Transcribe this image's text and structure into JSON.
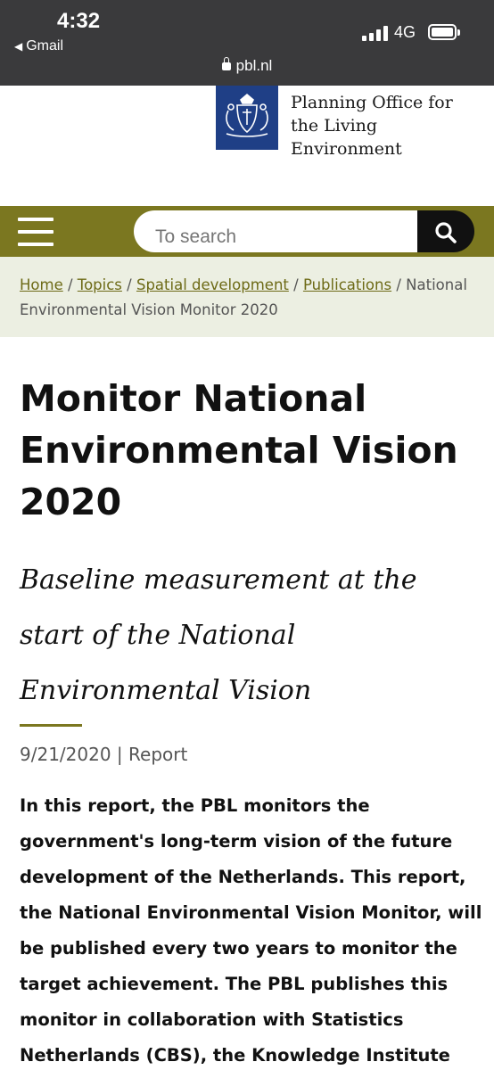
{
  "status_bar": {
    "time": "4:32",
    "back_app": "Gmail",
    "network": "4G",
    "url": "pbl.nl"
  },
  "header": {
    "logo_text": [
      "Planning Office for",
      "the Living",
      "Environment"
    ],
    "emblem_color": "#1f3f86"
  },
  "nav": {
    "color": "#7b7720",
    "search_placeholder": "To search",
    "menu_icon": "hamburger-icon",
    "search_icon": "search-icon"
  },
  "breadcrumb": {
    "items": [
      "Home",
      "Topics",
      "Spatial development",
      "Publications"
    ],
    "current": "National Environmental Vision Monitor 2020",
    "separator": "/"
  },
  "article": {
    "title": "Monitor National Environmental Vision 2020",
    "subtitle": "Baseline measurement at the start of the National Environmental Vision",
    "date": "9/21/2020",
    "type": "Report",
    "lead": "In this report, the PBL monitors the government's long-term vision of the future development of the Netherlands. This report, the National Environmental Vision Monitor, will be published every two years to monitor the target achievement. The PBL publishes this monitor in collaboration with Statistics Netherlands (CBS), the Knowledge Institute for"
  }
}
